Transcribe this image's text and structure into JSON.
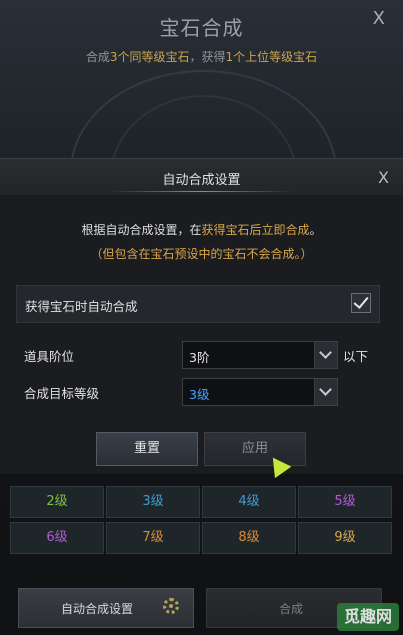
{
  "background": {
    "title": "宝石合成",
    "close": "X",
    "desc_pre": "合成",
    "desc_hl1": "3个同等级宝石",
    "desc_mid": "，获得",
    "desc_hl2": "1个上位等级宝石"
  },
  "modal": {
    "title": "自动合成设置",
    "close": "X",
    "notice_pre": "根据自动合成设置，在",
    "notice_hl": "获得宝石后立即合成",
    "notice_post": "。",
    "notice2": "（但包含在宝石预设中的宝石不会合成。）",
    "auto_label": "获得宝石时自动合成",
    "auto_checked": true,
    "item_tier_label": "道具阶位",
    "item_tier_value": "3阶",
    "item_tier_suffix": "以下",
    "target_level_label": "合成目标等级",
    "target_level_value": "3级",
    "reset_label": "重置",
    "apply_label": "应用"
  },
  "grades": [
    {
      "label": "2级",
      "color": "#7fbf3f"
    },
    {
      "label": "3级",
      "color": "#3d9bd6"
    },
    {
      "label": "4级",
      "color": "#3d9bd6"
    },
    {
      "label": "5级",
      "color": "#b25ad8"
    },
    {
      "label": "6级",
      "color": "#b25ad8"
    },
    {
      "label": "7级",
      "color": "#d88a3a"
    },
    {
      "label": "8级",
      "color": "#d88a3a"
    },
    {
      "label": "9级",
      "color": "#d8a84a"
    }
  ],
  "bottom": {
    "auto_settings_label": "自动合成设置",
    "synth_label": "合成"
  },
  "watermark": "觅趣网"
}
